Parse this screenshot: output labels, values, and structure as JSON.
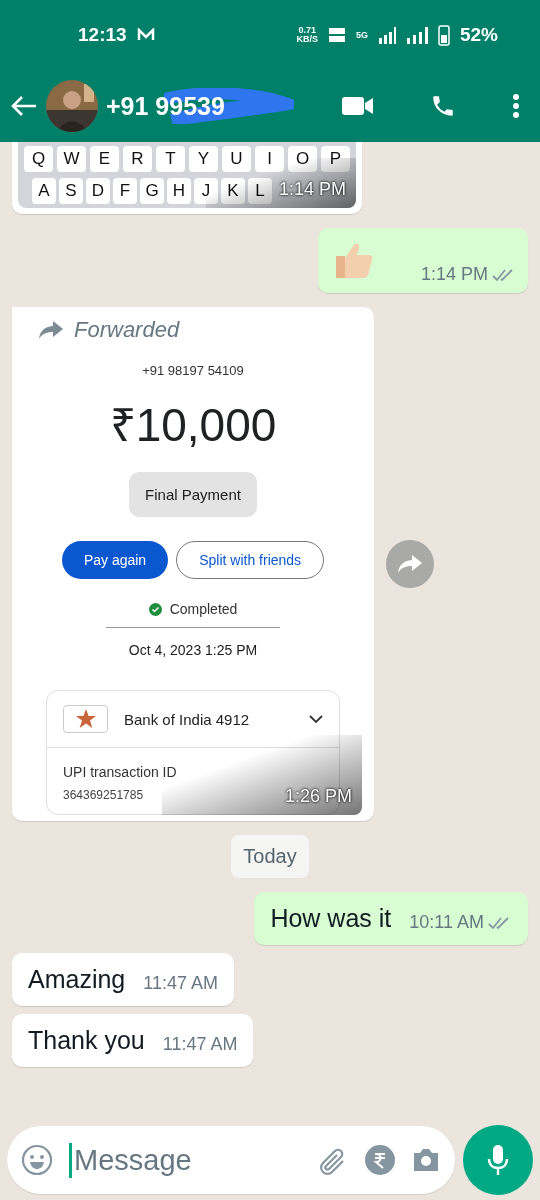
{
  "status_bar": {
    "time": "12:13",
    "speed": "0.71",
    "speed_unit": "KB/S",
    "network": "5G",
    "battery": "52%"
  },
  "header": {
    "title": "+91 99539"
  },
  "messages": [
    {
      "kind": "keyboard",
      "outgoing": false,
      "keys_top": [
        "Q",
        "W",
        "E",
        "R",
        "T",
        "Y",
        "U",
        "I",
        "O",
        "P"
      ],
      "keys_bottom": [
        "A",
        "S",
        "D",
        "F",
        "G",
        "H",
        "J",
        "K",
        "L"
      ],
      "time": "1:14 PM"
    },
    {
      "kind": "emoji",
      "outgoing": true,
      "time": "1:14 PM",
      "delivered": true
    },
    {
      "kind": "payment",
      "outgoing": false,
      "forwarded": true,
      "forwarded_label": "Forwarded",
      "phone": "+91 98197 54109",
      "amount": "₹10,000",
      "note": "Final Payment",
      "primary": "Pay again",
      "secondary": "Split with friends",
      "state": "Completed",
      "datetime": "Oct 4, 2023 1:25 PM",
      "bank": "Bank of India 4912",
      "txn_label": "UPI transaction ID",
      "txn_id": "364369251785",
      "time": "1:26 PM"
    },
    {
      "kind": "date",
      "text": "Today"
    },
    {
      "kind": "text",
      "outgoing": true,
      "text": "How was it",
      "time": "10:11 AM",
      "delivered": true
    },
    {
      "kind": "text",
      "outgoing": false,
      "text": "Amazing",
      "time": "11:47 AM"
    },
    {
      "kind": "text",
      "outgoing": false,
      "text": "Thank you",
      "time": "11:47 AM"
    }
  ],
  "composer": {
    "placeholder": "Message"
  }
}
